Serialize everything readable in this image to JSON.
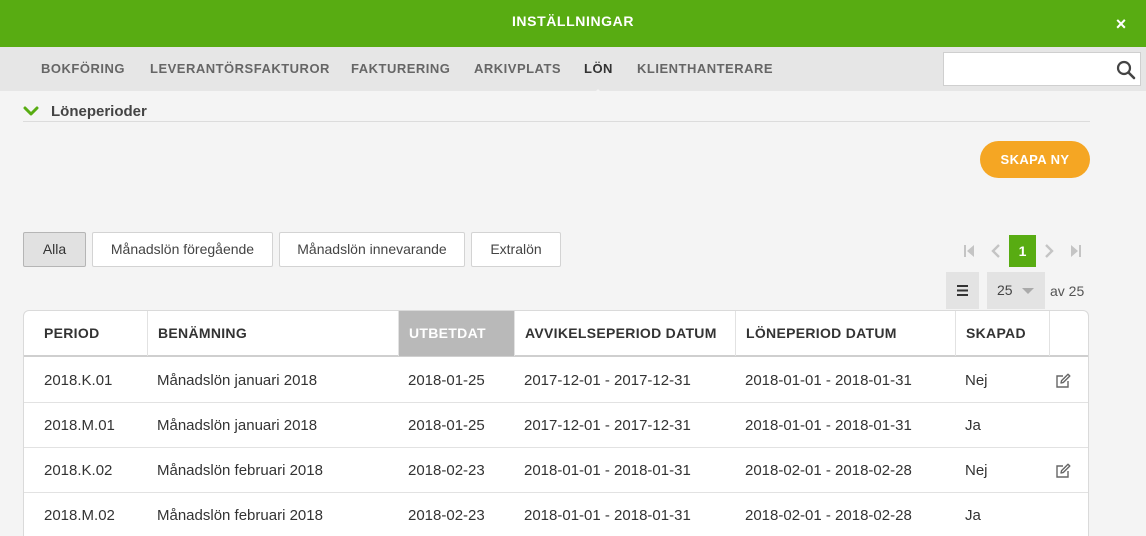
{
  "window": {
    "title": "INSTÄLLNINGAR",
    "close_label": "×"
  },
  "nav": {
    "tabs": [
      {
        "label": "BOKFÖRING"
      },
      {
        "label": "LEVERANTÖRSFAKTUROR"
      },
      {
        "label": "FAKTURERING"
      },
      {
        "label": "ARKIVPLATS"
      },
      {
        "label": "LÖN",
        "active": true
      },
      {
        "label": "KLIENTHANTERARE"
      }
    ],
    "search": {
      "value": "",
      "placeholder": "",
      "icon": "search-icon"
    }
  },
  "section": {
    "title": "Löneperioder",
    "icon": "chevron-down-icon",
    "expanded": true
  },
  "create_button": {
    "label": "SKAPA NY"
  },
  "filters": [
    {
      "label": "Alla",
      "active": true
    },
    {
      "label": "Månadslön föregående"
    },
    {
      "label": "Månadslön innevarande"
    },
    {
      "label": "Extralön"
    }
  ],
  "pagination": {
    "current_page": "1",
    "page_size": "25",
    "total_label": "av 25"
  },
  "table": {
    "columns": [
      "PERIOD",
      "BENÄMNING",
      "UTBETDAT",
      "AVVIKELSEPERIOD DATUM",
      "LÖNEPERIOD DATUM",
      "SKAPAD",
      ""
    ],
    "sorted_column": "UTBETDAT",
    "rows": [
      {
        "period": "2018.K.01",
        "name": "Månadslön januari 2018",
        "paid": "2018-01-25",
        "deviation": "2017-12-01 - 2017-12-31",
        "salary_period": "2018-01-01 - 2018-01-31",
        "created": "Nej",
        "editable": true
      },
      {
        "period": "2018.M.01",
        "name": "Månadslön januari 2018",
        "paid": "2018-01-25",
        "deviation": "2017-12-01 - 2017-12-31",
        "salary_period": "2018-01-01 - 2018-01-31",
        "created": "Ja",
        "editable": false
      },
      {
        "period": "2018.K.02",
        "name": "Månadslön februari 2018",
        "paid": "2018-02-23",
        "deviation": "2018-01-01 - 2018-01-31",
        "salary_period": "2018-02-01 - 2018-02-28",
        "created": "Nej",
        "editable": true
      },
      {
        "period": "2018.M.02",
        "name": "Månadslön februari 2018",
        "paid": "2018-02-23",
        "deviation": "2018-01-01 - 2018-01-31",
        "salary_period": "2018-02-01 - 2018-02-28",
        "created": "Ja",
        "editable": false
      }
    ]
  },
  "colors": {
    "brand": "#58ac12",
    "accent": "#f5a623",
    "sorted_header": "#b9b9b9"
  }
}
